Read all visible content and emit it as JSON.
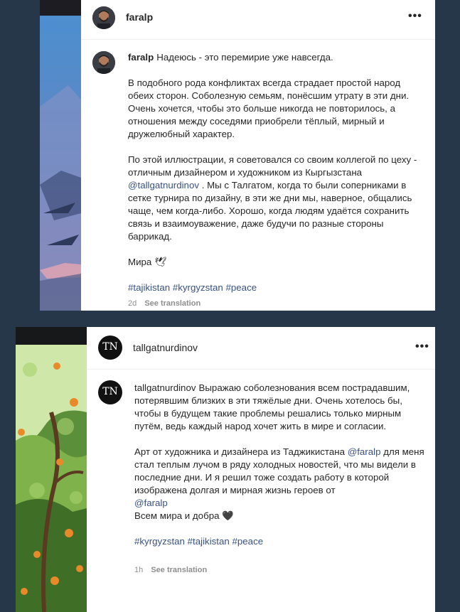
{
  "post1": {
    "username": "faralp",
    "header_more": "•••",
    "comment_user": "faralp",
    "p1": "Надеюсь - это перемирие уже навсегда.",
    "p2": "В подобного рода конфликтах всегда страдает простой народ обеих сторон. Соболезную семьям, понёсшим утрату в эти дни. Очень хочется, чтобы это больше никогда не повторилось, а отношения между соседями приобрели тёплый, мирный и дружелюбный характер.",
    "p3_before": "По этой иллюстрации, я советовался со своим коллегой по цеху - отличным дизайнером и художником из Кыргызстана",
    "mention": "@tallgatnurdinov",
    "p3_after": ". Мы с Талгатом, когда то были соперниками в сетке турнира по дизайну, в эти же дни мы, наверное, общались чаще, чем когда-либо. Хорошо, когда людям удаётся сохранить связь и взаимоуважение, даже будучи по разные стороны баррикад.",
    "p4": "Мира 🕊",
    "tag1": "#tajikistan",
    "tag2": "#kyrgyzstan",
    "tag3": "#peace",
    "time": "2d",
    "see_translation": "See translation"
  },
  "post2": {
    "username": "tallgatnurdinov",
    "avatar_text": "TN",
    "header_more": "•••",
    "comment_user": "tallgatnurdinov",
    "p1": "Выражаю соболезнования всем пострадавшим, потерявшим близких в эти тяжёлые дни. Очень хотелось бы, чтобы в будущем такие проблемы решались только мирным путём, ведь каждый народ хочет жить в мире и согласии.",
    "p2_before": "Арт от художника и дизайнера из Таджикистана",
    "mention1": "@faralp",
    "p2_mid": "для меня стал теплым лучом в ряду холодных новостей, что мы видели в последние дни. И я решил тоже создать работу в которой изображена долгая и мирная жизнь героев от",
    "mention2": "@faralp",
    "p2_end": "Всем мира и добра 🖤",
    "tag1": "#kyrgyzstan",
    "tag2": "#tajikistan",
    "tag3": "#peace",
    "time": "1h",
    "see_translation": "See translation"
  }
}
